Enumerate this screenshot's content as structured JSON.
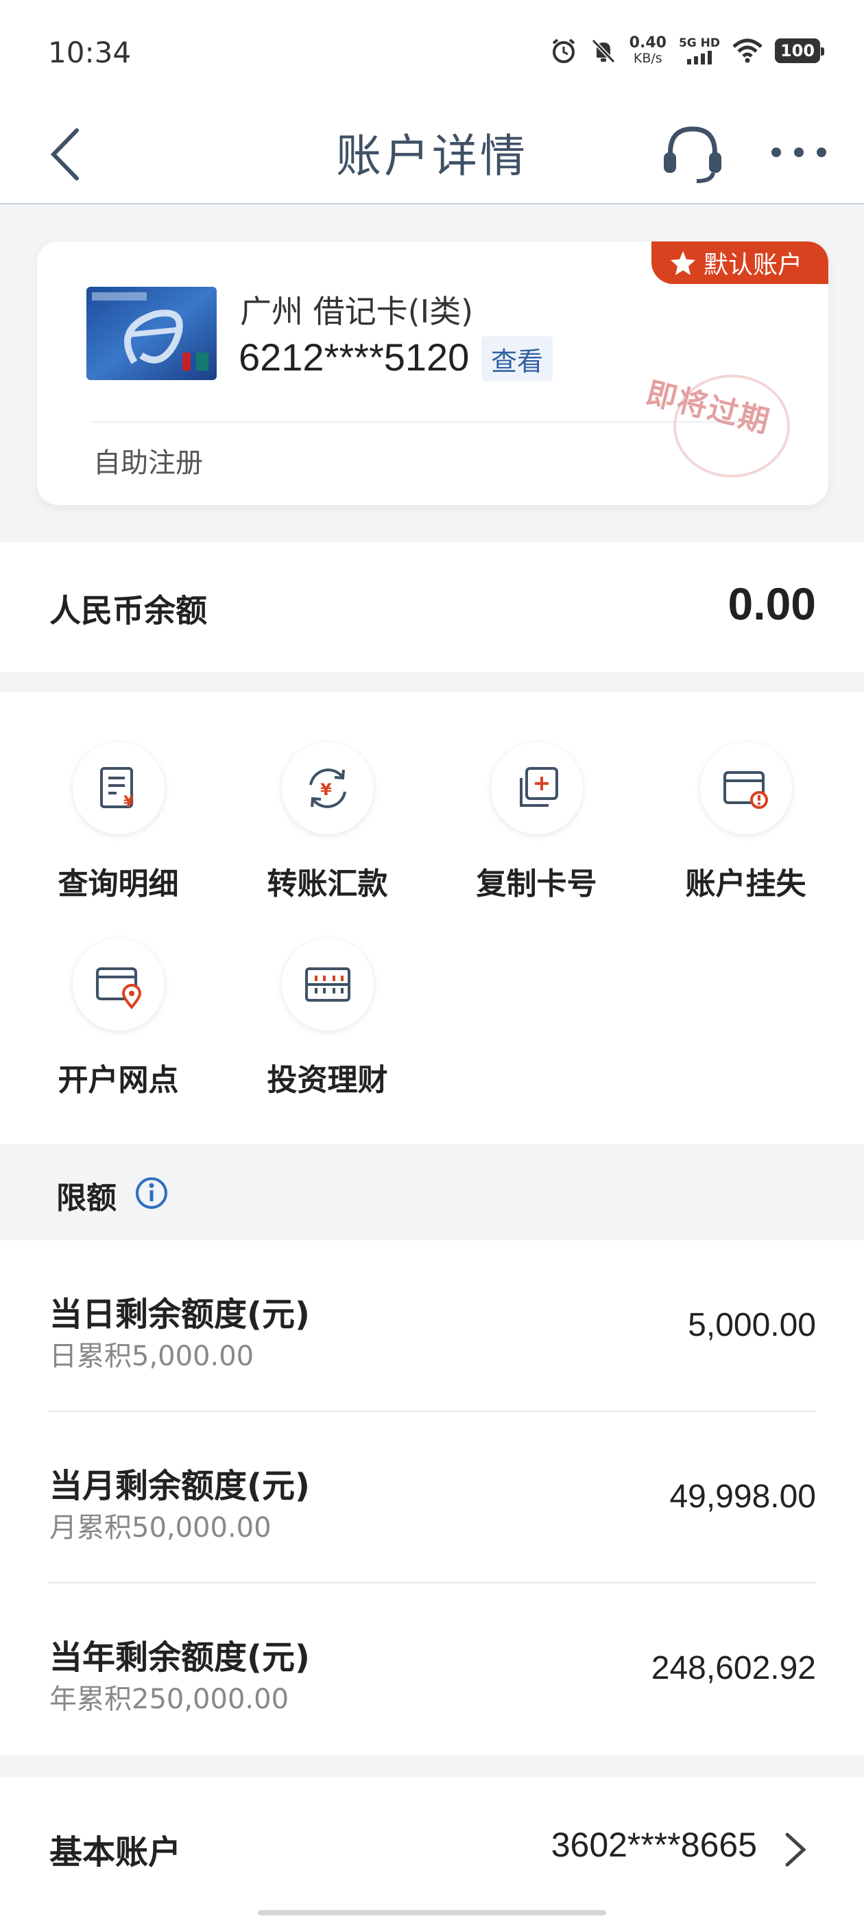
{
  "status_bar": {
    "time": "10:34",
    "net_speed_value": "0.40",
    "net_speed_unit": "KB/s",
    "signal_label": "5G HD",
    "battery": "100"
  },
  "header": {
    "title": "账户详情",
    "back_icon": "chevron-left-icon",
    "service_icon": "headset-icon",
    "more_icon": "more-dots-icon"
  },
  "card": {
    "badge": "默认账户",
    "name": "广州 借记卡(Ⅰ类)",
    "number": "6212****5120",
    "view_label": "查看",
    "register_label": "自助注册",
    "stamp": "即将过期"
  },
  "balance": {
    "label": "人民币余额",
    "value": "0.00"
  },
  "actions": [
    {
      "label": "查询明细",
      "icon": "statement-icon"
    },
    {
      "label": "转账汇款",
      "icon": "transfer-icon"
    },
    {
      "label": "复制卡号",
      "icon": "copy-icon"
    },
    {
      "label": "账户挂失",
      "icon": "card-alert-icon"
    },
    {
      "label": "开户网点",
      "icon": "branch-location-icon"
    },
    {
      "label": "投资理财",
      "icon": "investment-icon"
    }
  ],
  "limits": {
    "title": "限额",
    "items": [
      {
        "title": "当日剩余额度(元)",
        "sub": "日累积5,000.00",
        "value": "5,000.00"
      },
      {
        "title": "当月剩余额度(元)",
        "sub": "月累积50,000.00",
        "value": "49,998.00"
      },
      {
        "title": "当年剩余额度(元)",
        "sub": "年累积250,000.00",
        "value": "248,602.92"
      }
    ]
  },
  "basic_account": {
    "label": "基本账户",
    "value": "3602****8665"
  },
  "colors": {
    "accent_red": "#d9421f",
    "title_blue": "#3f5166",
    "link_blue": "#2f5fa0",
    "icon_red": "#d9421f"
  }
}
